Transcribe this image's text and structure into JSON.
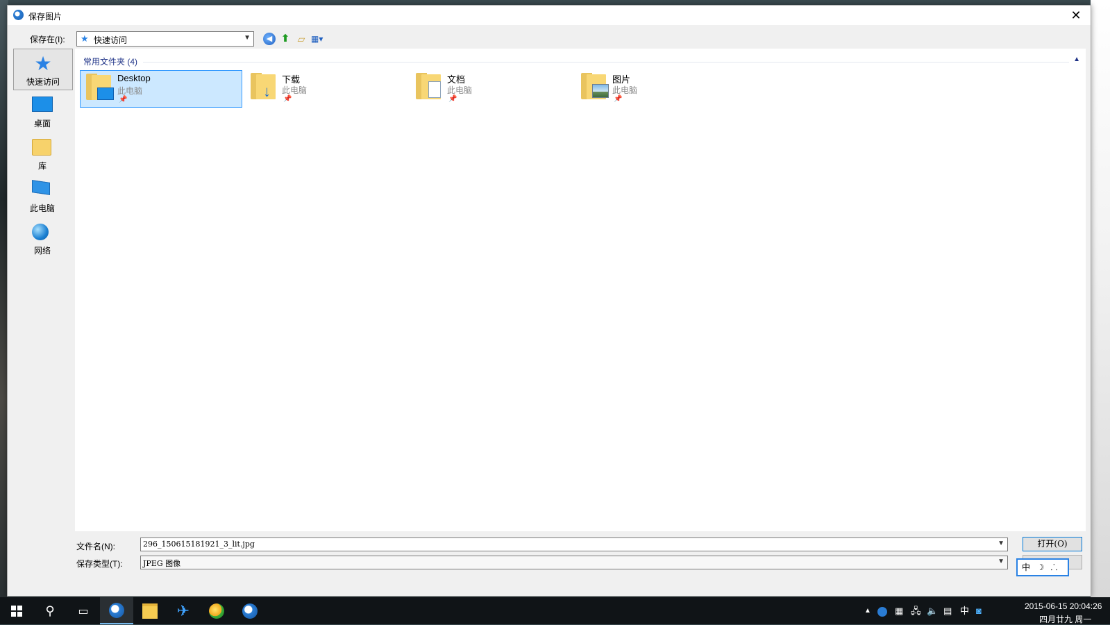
{
  "dialog": {
    "title": "保存图片",
    "close_glyph": "✕"
  },
  "lookin": {
    "label": "保存在(I):",
    "value": "快速访问"
  },
  "places": [
    {
      "label": "快速访问",
      "icon": "star-icon"
    },
    {
      "label": "桌面",
      "icon": "desktop-icon"
    },
    {
      "label": "库",
      "icon": "library-icon"
    },
    {
      "label": "此电脑",
      "icon": "computer-icon"
    },
    {
      "label": "网络",
      "icon": "network-icon"
    }
  ],
  "group": {
    "header": "常用文件夹 (4)"
  },
  "folders": [
    {
      "name": "Desktop",
      "location": "此电脑",
      "icon": "desktop-folder-icon"
    },
    {
      "name": "下载",
      "location": "此电脑",
      "icon": "downloads-folder-icon"
    },
    {
      "name": "文档",
      "location": "此电脑",
      "icon": "documents-folder-icon"
    },
    {
      "name": "图片",
      "location": "此电脑",
      "icon": "pictures-folder-icon"
    }
  ],
  "filename": {
    "label": "文件名(N):",
    "value": "296_150615181921_3_lit.jpg"
  },
  "filetype": {
    "label": "保存类型(T):",
    "value": "JPEG 图像"
  },
  "buttons": {
    "open": "打开(O)"
  },
  "ime": {
    "lang": "中",
    "moon": "☽",
    "sym": "⸫"
  },
  "tray": {
    "ime_lang": "中",
    "time": "2015-06-15  20:04:26",
    "date": "四月廿九 周一"
  },
  "colors": {
    "accent": "#0078d7",
    "selection": "#cce8ff",
    "group_header": "#1e3287"
  }
}
